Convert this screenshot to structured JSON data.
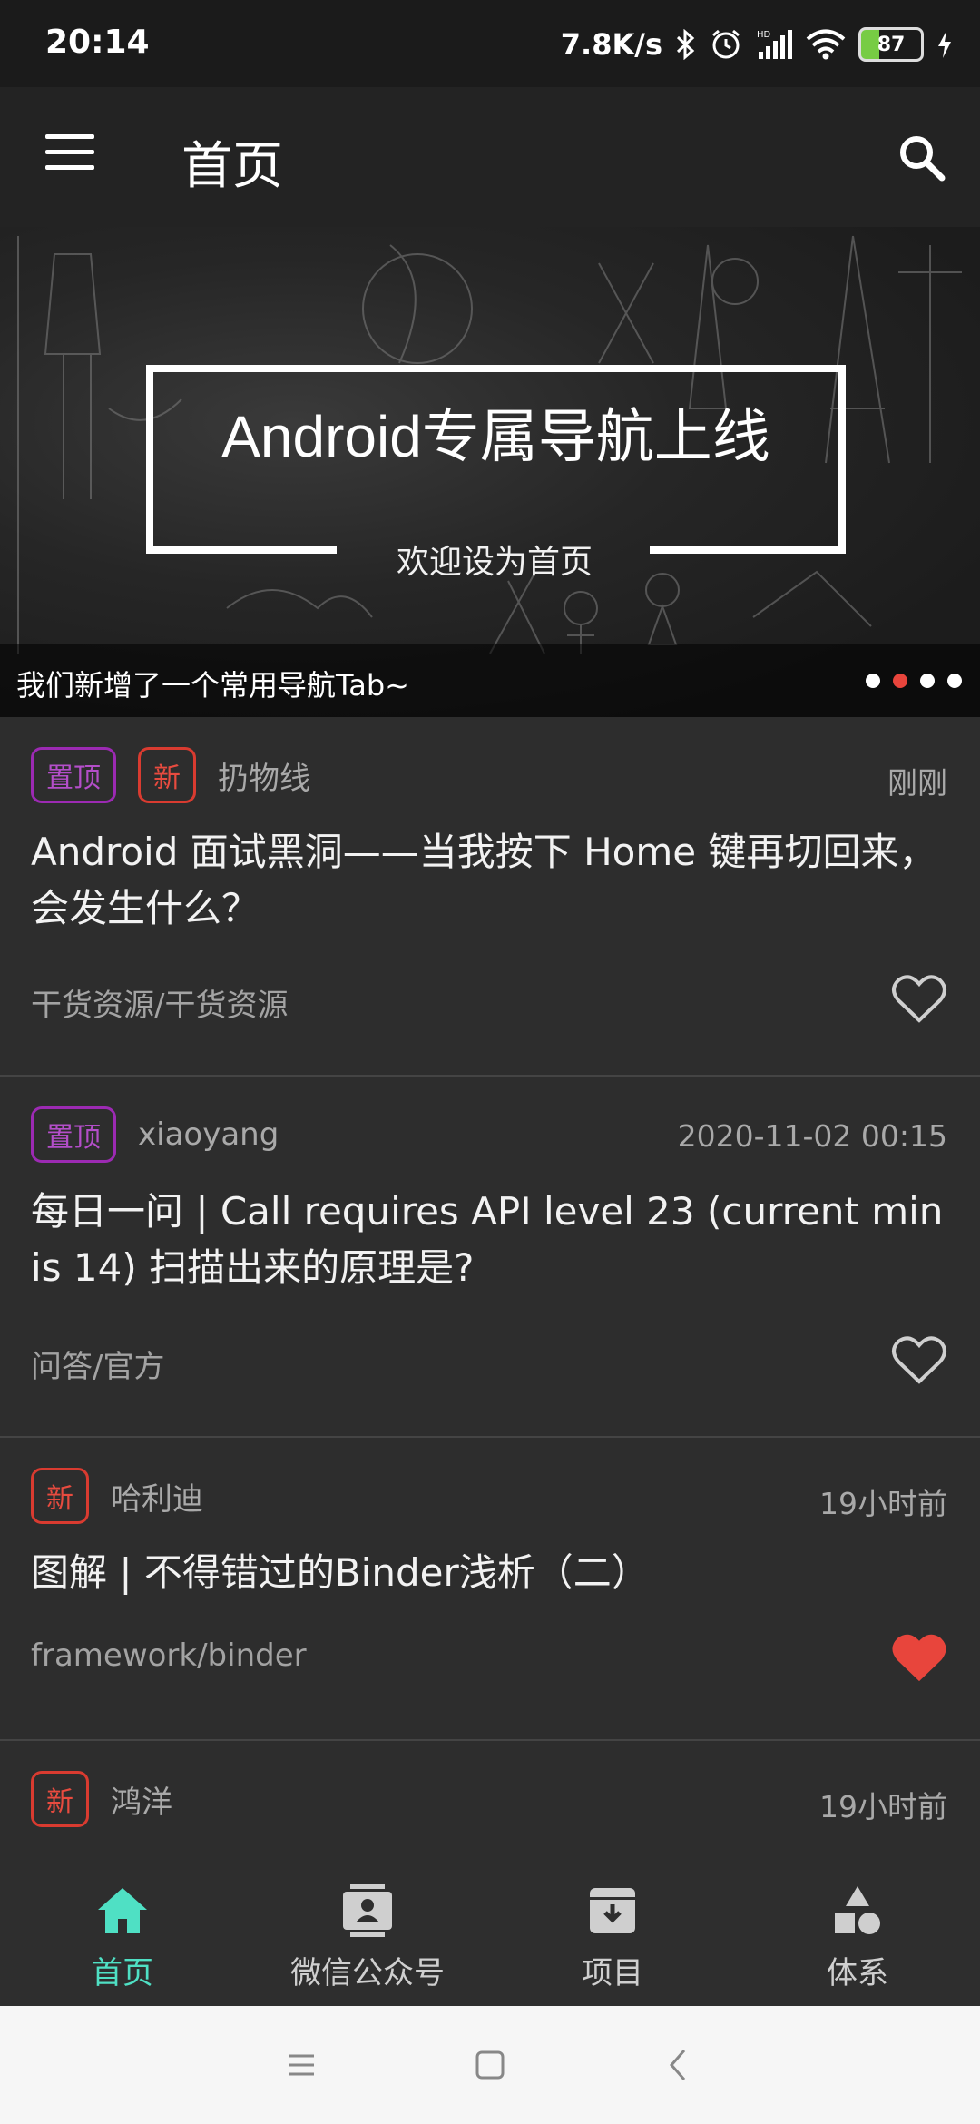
{
  "status_bar": {
    "time": "20:14",
    "net_speed": "7.8K/s",
    "battery": "87",
    "icons": [
      "bluetooth-icon",
      "alarm-icon",
      "signal-icon",
      "wifi-icon",
      "battery-icon",
      "charging-icon"
    ]
  },
  "app_bar": {
    "title": "首页",
    "icons": [
      "menu-icon",
      "search-icon"
    ]
  },
  "banner": {
    "headline": "Android专属导航上线",
    "subtitle": "欢迎设为首页",
    "caption": "我们新增了一个常用导航Tab~",
    "dot_count": 4,
    "active_dot": 2
  },
  "articles": [
    {
      "tags": [
        {
          "label": "置顶",
          "kind": "top"
        },
        {
          "label": "新",
          "kind": "new"
        }
      ],
      "author": "扔物线",
      "time": "刚刚",
      "title": "Android 面试黑洞——当我按下 Home 键再切回来，会发生什么？",
      "chapter": "干货资源/干货资源",
      "favorited": false
    },
    {
      "tags": [
        {
          "label": "置顶",
          "kind": "top"
        }
      ],
      "author": "xiaoyang",
      "time": "2020-11-02 00:15",
      "title": "每日一问 | Call requires API level 23 (current min is 14) 扫描出来的原理是?",
      "chapter": "问答/官方",
      "favorited": false
    },
    {
      "tags": [
        {
          "label": "新",
          "kind": "new"
        }
      ],
      "author": "哈利迪",
      "time": "19小时前",
      "title": "图解 | 不得错过的Binder浅析（二）",
      "chapter": "framework/binder",
      "favorited": true
    },
    {
      "tags": [
        {
          "label": "新",
          "kind": "new"
        }
      ],
      "author": "鸿洋",
      "time": "19小时前",
      "title": "",
      "chapter": "",
      "favorited": false
    }
  ],
  "bottom_nav": [
    {
      "label": "首页",
      "icon": "home-icon",
      "active": true
    },
    {
      "label": "微信公众号",
      "icon": "contact-card-icon",
      "active": false
    },
    {
      "label": "项目",
      "icon": "archive-box-icon",
      "active": false
    },
    {
      "label": "体系",
      "icon": "shapes-icon",
      "active": false
    }
  ],
  "colors": {
    "accent": "#4fe0c4",
    "tag_top": "#b44ec9",
    "tag_new": "#e84b3f",
    "heart_filled": "#e8453c"
  }
}
